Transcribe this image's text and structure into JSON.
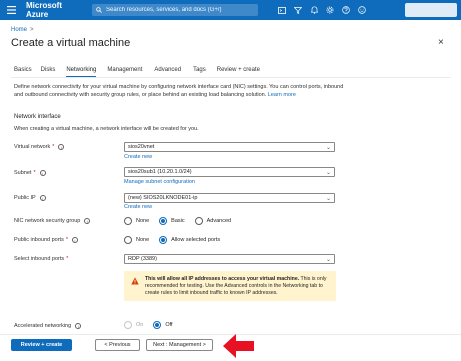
{
  "header": {
    "brand": "Microsoft Azure",
    "search_placeholder": "Search resources, services, and docs (G+/)",
    "icons": [
      "terminal-icon",
      "filter-icon",
      "bell-icon",
      "gear-icon",
      "question-icon",
      "feedback-icon"
    ],
    "accent_color": "#0f6cbd"
  },
  "breadcrumb": {
    "home": "Home",
    "separator": ">"
  },
  "page": {
    "title": "Create a virtual machine",
    "close": "×"
  },
  "tabs": [
    {
      "label": "Basics",
      "active": false
    },
    {
      "label": "Disks",
      "active": false
    },
    {
      "label": "Networking",
      "active": true
    },
    {
      "label": "Management",
      "active": false
    },
    {
      "label": "Advanced",
      "active": false
    },
    {
      "label": "Tags",
      "active": false
    },
    {
      "label": "Review + create",
      "active": false
    }
  ],
  "intro": {
    "text": "Define network connectivity for your virtual machine by configuring network interface card (NIC) settings. You can control ports, inbound and outbound connectivity with security group rules, or place behind an existing load balancing solution.",
    "learn_more": "Learn more"
  },
  "network_interface": {
    "heading": "Network interface",
    "description": "When creating a virtual machine, a network interface will be created for you."
  },
  "fields": {
    "virtual_network": {
      "label": "Virtual network",
      "required": "*",
      "value": "sios20vnet",
      "link": "Create new"
    },
    "subnet": {
      "label": "Subnet",
      "required": "*",
      "value": "sios20sub1 (10.20.1.0/24)",
      "link": "Manage subnet configuration"
    },
    "public_ip": {
      "label": "Public IP",
      "value": "(new) SIOS20LKNODE01-ip",
      "link": "Create new"
    },
    "nsg": {
      "label": "NIC network security group",
      "options": [
        "None",
        "Basic",
        "Advanced"
      ],
      "selected": "Basic"
    },
    "public_inbound_ports": {
      "label": "Public inbound ports",
      "required": "*",
      "options": [
        "None",
        "Allow selected ports"
      ],
      "selected": "Allow selected ports"
    },
    "select_inbound_ports": {
      "label": "Select inbound ports",
      "required": "*",
      "value": "RDP (3389)"
    },
    "accelerated_networking": {
      "label": "Accelerated networking",
      "options": [
        "On",
        "Off"
      ],
      "selected": "Off"
    }
  },
  "warning": {
    "bold": "This will allow all IP addresses to access your virtual machine.",
    "text": " This is only recommended for testing.  Use the Advanced controls in the Networking tab to create rules to limit inbound traffic to known IP addresses."
  },
  "footer": {
    "review_create": "Review + create",
    "previous": "< Previous",
    "next": "Next : Management >"
  },
  "annotation_color": "#e81123"
}
